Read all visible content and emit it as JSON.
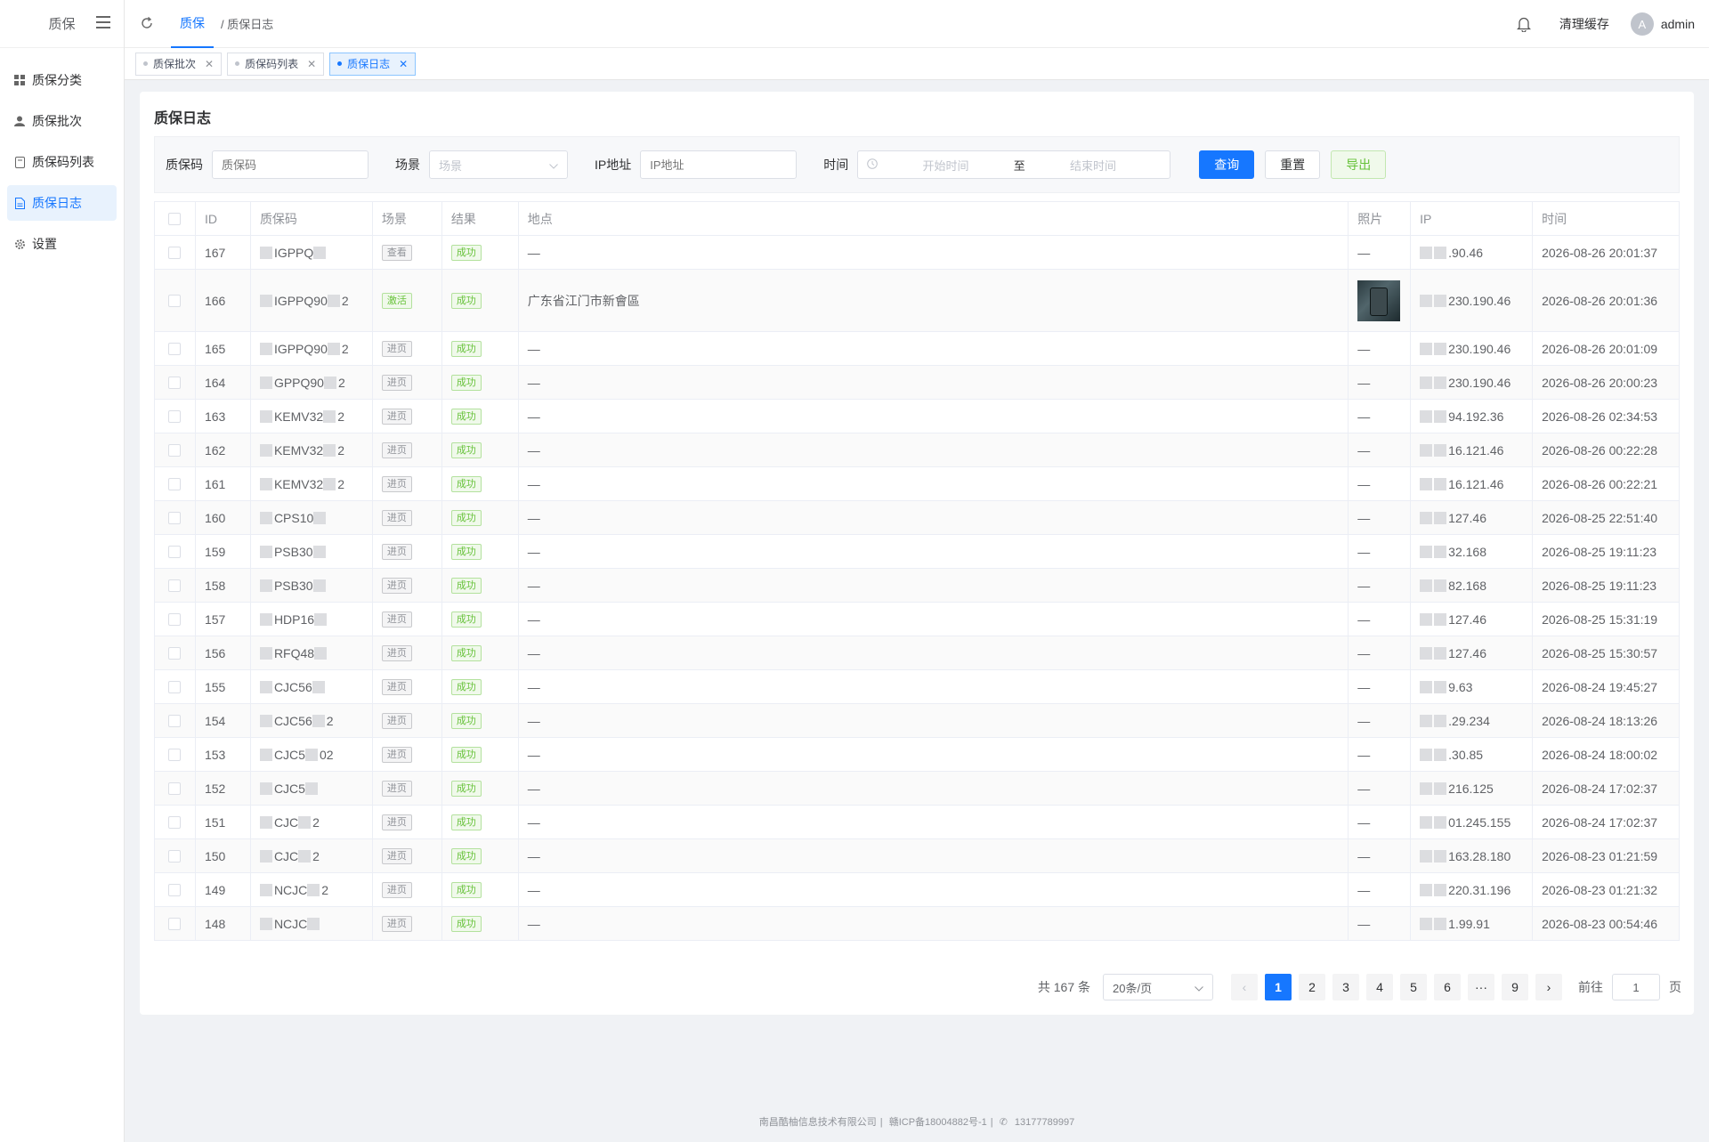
{
  "sidebar": {
    "logo": "质保",
    "items": [
      {
        "label": "质保分类",
        "icon": "grid-icon"
      },
      {
        "label": "质保批次",
        "icon": "user-icon"
      },
      {
        "label": "质保码列表",
        "icon": "file-icon"
      },
      {
        "label": "质保日志",
        "icon": "document-icon",
        "active": true
      },
      {
        "label": "设置",
        "icon": "gear-icon"
      }
    ]
  },
  "header": {
    "crumb_active": "质保",
    "crumb_sub": "/ 质保日志",
    "clear_cache": "清理缓存",
    "avatar_letter": "A",
    "username": "admin"
  },
  "tabs": [
    {
      "label": "质保批次",
      "active": false
    },
    {
      "label": "质保码列表",
      "active": false
    },
    {
      "label": "质保日志",
      "active": true
    }
  ],
  "page": {
    "title": "质保日志"
  },
  "search": {
    "code_label": "质保码",
    "code_placeholder": "质保码",
    "scene_label": "场景",
    "scene_placeholder": "场景",
    "ip_label": "IP地址",
    "ip_placeholder": "IP地址",
    "time_label": "时间",
    "start_placeholder": "开始时间",
    "range_sep": "至",
    "end_placeholder": "结束时间",
    "query_btn": "查询",
    "reset_btn": "重置",
    "export_btn": "导出"
  },
  "table": {
    "headers": {
      "id": "ID",
      "code": "质保码",
      "scene": "场景",
      "result": "结果",
      "location": "地点",
      "photo": "照片",
      "ip": "IP",
      "time": "时间"
    },
    "rows": [
      {
        "id": "167",
        "code": "IGPPQ",
        "scene": "查看",
        "result": "成功",
        "location": "—",
        "photo": "—",
        "ip": ".90.46",
        "time": "2026-08-26 20:01:37"
      },
      {
        "id": "166",
        "code": "IGPPQ90",
        "code_tail": "2",
        "scene": "激活",
        "result": "成功",
        "location": "广东省江门市新會區",
        "photo": "",
        "ip": "230.190.46",
        "time": "2026-08-26 20:01:36"
      },
      {
        "id": "165",
        "code": "IGPPQ90",
        "code_tail": "2",
        "scene": "进页",
        "result": "成功",
        "location": "—",
        "photo": "—",
        "ip": "230.190.46",
        "time": "2026-08-26 20:01:09"
      },
      {
        "id": "164",
        "code": "GPPQ90",
        "code_tail": "2",
        "scene": "进页",
        "result": "成功",
        "location": "—",
        "photo": "—",
        "ip": "230.190.46",
        "time": "2026-08-26 20:00:23"
      },
      {
        "id": "163",
        "code": "KEMV32",
        "code_tail": "2",
        "scene": "进页",
        "result": "成功",
        "location": "—",
        "photo": "—",
        "ip": "94.192.36",
        "time": "2026-08-26 02:34:53"
      },
      {
        "id": "162",
        "code": "KEMV32",
        "code_tail": "2",
        "scene": "进页",
        "result": "成功",
        "location": "—",
        "photo": "—",
        "ip": "16.121.46",
        "time": "2026-08-26 00:22:28"
      },
      {
        "id": "161",
        "code": "KEMV32",
        "code_tail": "2",
        "scene": "进页",
        "result": "成功",
        "location": "—",
        "photo": "—",
        "ip": "16.121.46",
        "time": "2026-08-26 00:22:21"
      },
      {
        "id": "160",
        "code": "CPS10",
        "scene": "进页",
        "result": "成功",
        "location": "—",
        "photo": "—",
        "ip": "127.46",
        "time": "2026-08-25 22:51:40"
      },
      {
        "id": "159",
        "code": "PSB30",
        "scene": "进页",
        "result": "成功",
        "location": "—",
        "photo": "—",
        "ip": "32.168",
        "time": "2026-08-25 19:11:23"
      },
      {
        "id": "158",
        "code": "PSB30",
        "scene": "进页",
        "result": "成功",
        "location": "—",
        "photo": "—",
        "ip": "82.168",
        "time": "2026-08-25 19:11:23"
      },
      {
        "id": "157",
        "code": "HDP16",
        "scene": "进页",
        "result": "成功",
        "location": "—",
        "photo": "—",
        "ip": "127.46",
        "time": "2026-08-25 15:31:19"
      },
      {
        "id": "156",
        "code": "RFQ48",
        "scene": "进页",
        "result": "成功",
        "location": "—",
        "photo": "—",
        "ip": "127.46",
        "time": "2026-08-25 15:30:57"
      },
      {
        "id": "155",
        "code": "CJC56",
        "scene": "进页",
        "result": "成功",
        "location": "—",
        "photo": "—",
        "ip": "9.63",
        "time": "2026-08-24 19:45:27"
      },
      {
        "id": "154",
        "code": "CJC56",
        "code_tail": "2",
        "scene": "进页",
        "result": "成功",
        "location": "—",
        "photo": "—",
        "ip": ".29.234",
        "time": "2026-08-24 18:13:26"
      },
      {
        "id": "153",
        "code": "CJC5",
        "code_tail": "02",
        "scene": "进页",
        "result": "成功",
        "location": "—",
        "photo": "—",
        "ip": ".30.85",
        "time": "2026-08-24 18:00:02"
      },
      {
        "id": "152",
        "code": "CJC5",
        "scene": "进页",
        "result": "成功",
        "location": "—",
        "photo": "—",
        "ip": "216.125",
        "time": "2026-08-24 17:02:37"
      },
      {
        "id": "151",
        "code": "CJC",
        "code_tail": "2",
        "scene": "进页",
        "result": "成功",
        "location": "—",
        "photo": "—",
        "ip": "01.245.155",
        "time": "2026-08-24 17:02:37"
      },
      {
        "id": "150",
        "code": "CJC",
        "code_tail": "2",
        "scene": "进页",
        "result": "成功",
        "location": "—",
        "photo": "—",
        "ip": "163.28.180",
        "time": "2026-08-23 01:21:59"
      },
      {
        "id": "149",
        "code": "NCJC",
        "code_tail": "2",
        "scene": "进页",
        "result": "成功",
        "location": "—",
        "photo": "—",
        "ip": "220.31.196",
        "time": "2026-08-23 01:21:32"
      },
      {
        "id": "148",
        "code": "NCJC",
        "scene": "进页",
        "result": "成功",
        "location": "—",
        "photo": "—",
        "ip": "1.99.91",
        "time": "2026-08-23 00:54:46"
      }
    ]
  },
  "pagination": {
    "total_text": "共 167 条",
    "page_size": "20条/页",
    "pages": [
      "1",
      "2",
      "3",
      "4",
      "5",
      "6",
      "···",
      "9"
    ],
    "current": "1",
    "goto_label": "前往",
    "goto_value": "1",
    "goto_suffix": "页"
  },
  "footer": {
    "company": "南昌酷柚信息技术有限公司",
    "icp": "赣ICP备18004882号-1",
    "phone": "13177789997"
  },
  "colors": {
    "primary": "#1677ff",
    "success": "#67c23a"
  }
}
